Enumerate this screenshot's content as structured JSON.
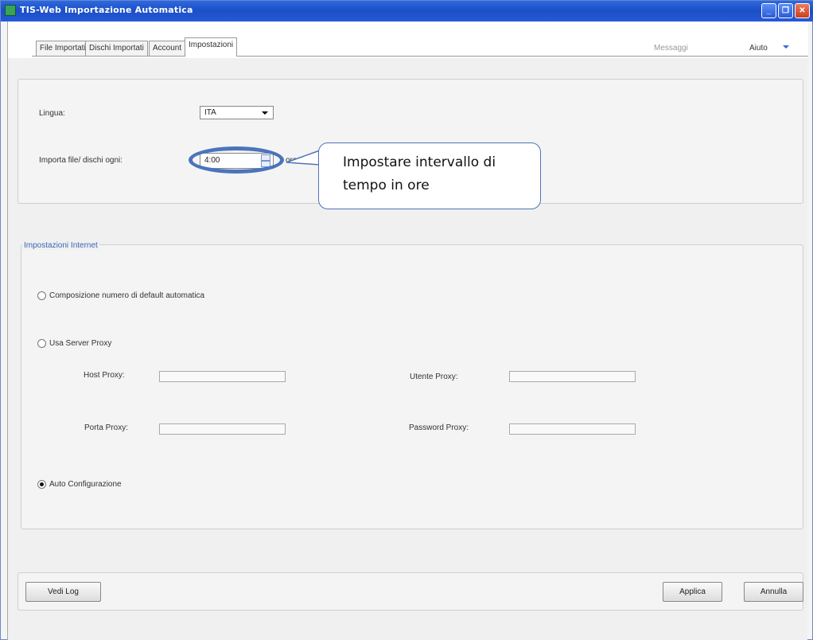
{
  "window": {
    "title": "TIS-Web Importazione Automatica",
    "minimize": "_",
    "restore": "❐",
    "close": "✕"
  },
  "tabs": [
    {
      "label": "File Importati"
    },
    {
      "label": "Dischi Importati"
    },
    {
      "label": "Account"
    },
    {
      "label": "Impostazioni",
      "active": true
    }
  ],
  "menu": {
    "messages": "Messaggi",
    "help": "Aiuto"
  },
  "settings": {
    "language_label": "Lingua:",
    "language_value": "ITA",
    "import_interval_label": "Importa file/ dischi ogni:",
    "import_interval_value": "4:00",
    "interval_unit": "ore"
  },
  "callout": {
    "line1": "Impostare intervallo di",
    "line2": "tempo in ore"
  },
  "internet": {
    "group_title": "Impostazioni Internet",
    "option_default_dial": "Composizione numero di default automatica",
    "option_proxy": "Usa Server Proxy",
    "host_proxy_label": "Host Proxy:",
    "host_proxy_value": "",
    "user_proxy_label": "Utente Proxy:",
    "user_proxy_value": "",
    "port_proxy_label": "Porta Proxy:",
    "port_proxy_value": "",
    "password_proxy_label": "Password Proxy:",
    "password_proxy_value": "",
    "option_auto": "Auto Configurazione",
    "selected": "auto"
  },
  "footer": {
    "view_log": "Vedi Log",
    "apply": "Applica",
    "cancel": "Annulla"
  },
  "colors": {
    "titlebar": "#2559d6",
    "group_title": "#3a66b8",
    "highlight": "#4a74bd"
  }
}
